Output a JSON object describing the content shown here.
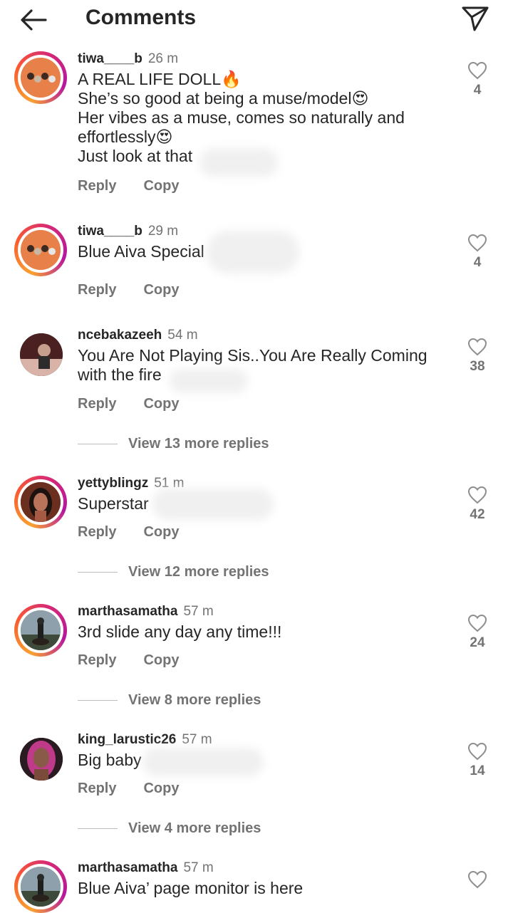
{
  "header": {
    "title": "Comments",
    "back_icon": "back-arrow-icon",
    "send_icon": "paper-plane-icon"
  },
  "comments": [
    {
      "username": "tiwa____b",
      "time": "26 m",
      "lines": [
        "A REAL LIFE DOLL🔥",
        "She’s so good at being a muse/model😍",
        "Her vibes as a muse, comes so naturally and",
        "effortlessly😍",
        "Just look at that"
      ],
      "likes": "4",
      "reply": "Reply",
      "copy": "Copy"
    },
    {
      "username": "tiwa____b",
      "time": "29 m",
      "lines": [
        "Blue Aiva Special"
      ],
      "likes": "4",
      "reply": "Reply",
      "copy": "Copy"
    },
    {
      "username": "ncebakazeeh",
      "time": "54 m",
      "lines": [
        "You Are Not Playing Sis..You Are Really Coming",
        "with the fire"
      ],
      "likes": "38",
      "reply": "Reply",
      "copy": "Copy",
      "view_more": "View 13 more replies"
    },
    {
      "username": "yettyblingz",
      "time": "51 m",
      "lines": [
        "Superstar"
      ],
      "likes": "42",
      "reply": "Reply",
      "copy": "Copy",
      "view_more": "View 12 more replies"
    },
    {
      "username": "marthasamatha",
      "time": "57 m",
      "lines": [
        "3rd slide any day any time!!!"
      ],
      "likes": "24",
      "reply": "Reply",
      "copy": "Copy",
      "view_more": "View 8 more replies"
    },
    {
      "username": "king_larustic26",
      "time": "57 m",
      "lines": [
        "Big baby"
      ],
      "likes": "14",
      "reply": "Reply",
      "copy": "Copy",
      "view_more": "View 4 more replies"
    },
    {
      "username": "marthasamatha",
      "time": "57 m",
      "lines": [
        "Blue Aiva’ page monitor is here"
      ],
      "likes": "",
      "reply": "",
      "copy": ""
    }
  ],
  "colors": {
    "text": "#262626",
    "secondary": "#737373",
    "story_ring": [
      "#f9a130",
      "#fb5d2e",
      "#d62976"
    ]
  }
}
